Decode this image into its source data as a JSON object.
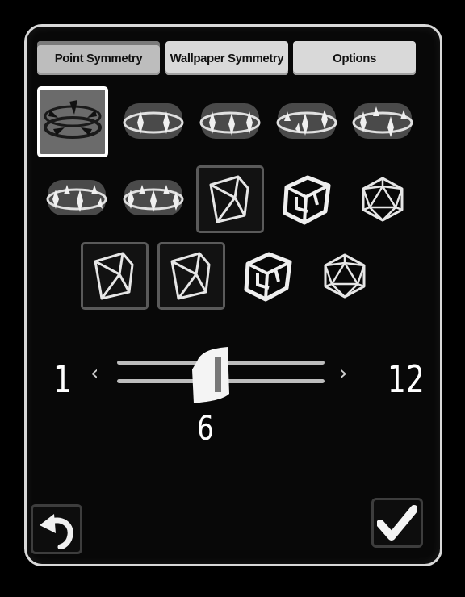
{
  "tabs": [
    {
      "label": "Point Symmetry",
      "active": true
    },
    {
      "label": "Wallpaper Symmetry",
      "active": false
    },
    {
      "label": "Options",
      "active": false
    }
  ],
  "symmetry_options": [
    {
      "icon": "ring-spikes-icon",
      "selected": true
    },
    {
      "icon": "ring-spikes-icon",
      "selected": false
    },
    {
      "icon": "ring-spikes-icon",
      "selected": false
    },
    {
      "icon": "ring-spikes-icon",
      "selected": false
    },
    {
      "icon": "ring-spikes-icon",
      "selected": false
    },
    {
      "icon": "ring-spikes-icon",
      "selected": false
    },
    {
      "icon": "ring-spikes-icon",
      "selected": false
    },
    {
      "icon": "prism-icon",
      "selected": false
    },
    {
      "icon": "cube-icon",
      "selected": false
    },
    {
      "icon": "icosahedron-icon",
      "selected": false
    },
    {
      "icon": "prism-icon",
      "selected": false
    },
    {
      "icon": "prism-icon",
      "selected": false
    },
    {
      "icon": "cube-icon",
      "selected": false
    },
    {
      "icon": "icosahedron-icon",
      "selected": false
    }
  ],
  "slider": {
    "min_label": "1",
    "max_label": "12",
    "value_label": "6",
    "min": 1,
    "max": 12,
    "value": 6,
    "decrease_glyph": "‹",
    "increase_glyph": "›"
  },
  "footer": {
    "undo_icon": "undo-arrow-icon",
    "confirm_icon": "checkmark-icon"
  }
}
